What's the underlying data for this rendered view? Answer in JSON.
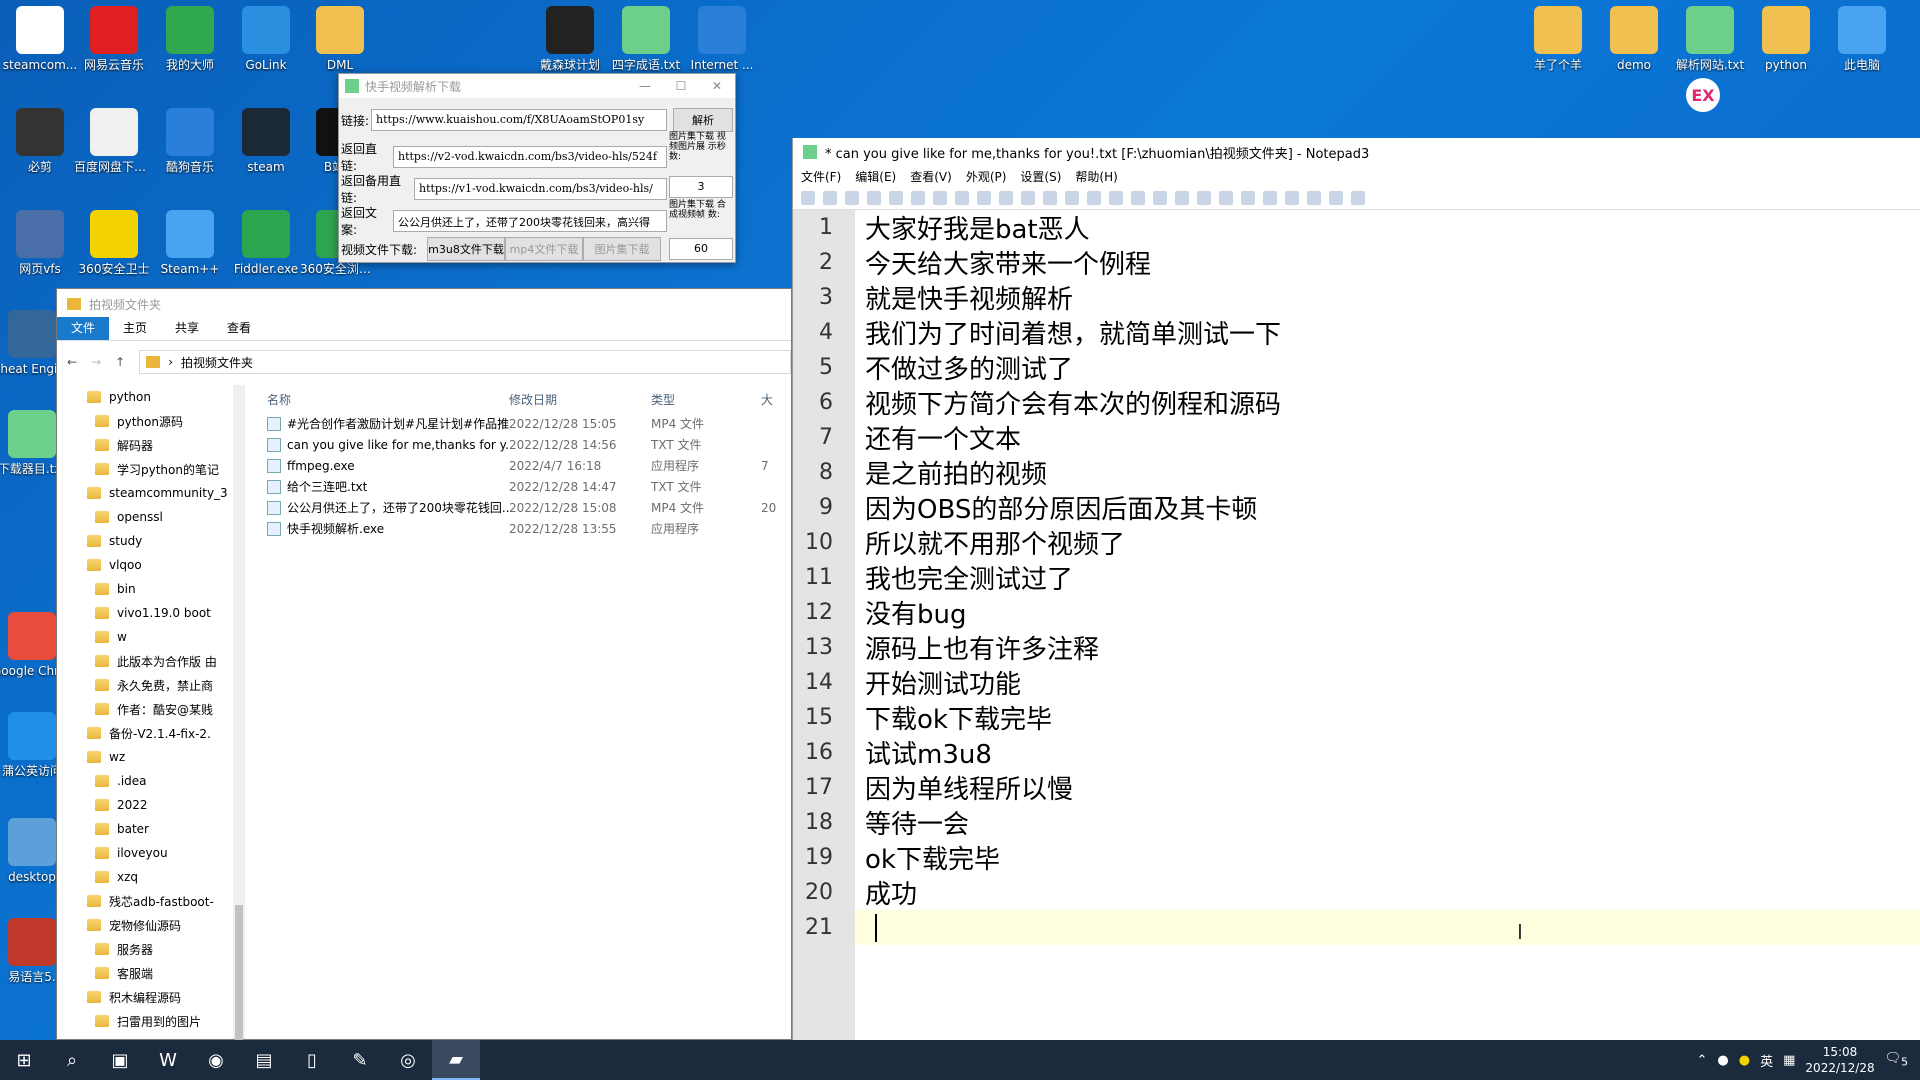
{
  "desktop": {
    "icons_left": [
      {
        "label": "steamcom...",
        "color": "#ffffff"
      },
      {
        "label": "网易云音乐",
        "color": "#e02020"
      },
      {
        "label": "我的大师",
        "color": "#2fa84f"
      },
      {
        "label": "GoLink",
        "color": "#2b8fe0"
      },
      {
        "label": "DML",
        "color": "#f0c050"
      },
      {
        "label": "戴森球计划",
        "color": "#222222"
      },
      {
        "label": "四字成语.txt",
        "color": "#6ccf8a"
      },
      {
        "label": "Internet ...",
        "color": "#2a7fd8"
      }
    ],
    "icons_row2": [
      {
        "label": "必剪",
        "color": "#333333"
      },
      {
        "label": "百度网盘下载 完毕提示音...",
        "color": "#f0f0f0"
      },
      {
        "label": "酷狗音乐",
        "color": "#2a7fd8"
      },
      {
        "label": "steam",
        "color": "#1b2838"
      },
      {
        "label": "B站弹",
        "color": "#111111"
      }
    ],
    "icons_row3": [
      {
        "label": "网页vfs",
        "color": "#4a6fa8"
      },
      {
        "label": "360安全卫士",
        "color": "#f2d200"
      },
      {
        "label": "Steam++",
        "color": "#4aa3f0"
      },
      {
        "label": "Fiddler.exe",
        "color": "#2da44e"
      },
      {
        "label": "360安全浏览器",
        "color": "#2da44e"
      }
    ],
    "icons_col": [
      {
        "label": "Cheat Engine",
        "color": "#336699"
      },
      {
        "label": "下载器目.txt",
        "color": "#6ccf8a"
      },
      {
        "label": "Google Chrome",
        "color": "#e84c3d"
      },
      {
        "label": "蒲公英访问",
        "color": "#1f8fe8"
      },
      {
        "label": "desktop",
        "color": "#5ba0d8"
      },
      {
        "label": "易语言5.",
        "color": "#c0392b"
      }
    ],
    "icons_right": [
      {
        "label": "羊了个羊",
        "color": "#f0c050"
      },
      {
        "label": "demo",
        "color": "#f0c050"
      },
      {
        "label": "解析网站.txt",
        "color": "#6ccf8a"
      },
      {
        "label": "python",
        "color": "#f0c050"
      },
      {
        "label": "此电脑",
        "color": "#4aa3f0"
      }
    ],
    "ex_badge": "EX"
  },
  "tool": {
    "title": "快手视频解析下载",
    "link_label": "链接:",
    "link_value": "https://www.kuaishou.com/f/X8UAoamStOP01sy",
    "parse_button": "解析",
    "direct_label": "返回直链:",
    "direct_value": "https://v2-vod.kwaicdn.com/bs3/video-hls/524f",
    "backup_label": "返回备用直链:",
    "backup_value": "https://v1-vod.kwaicdn.com/bs3/video-hls/",
    "caption_label": "返回文案:",
    "caption_value": "公公月供还上了，还带了200块零花钱回来，高兴得",
    "download_label": "视频文件下载:",
    "m3u8_button": "m3u8文件下载",
    "mp4_button": "mp4文件下载",
    "imgset_button": "图片集下载",
    "side_label1": "图片集下载 视频图片展 示秒数:",
    "side_value1": "3",
    "side_label2": "图片集下载 合成视频帧 数:",
    "side_value2": "60"
  },
  "explorer": {
    "title": "拍视频文件夹",
    "tabs": [
      "文件",
      "主页",
      "共享",
      "查看"
    ],
    "path": "拍视频文件夹",
    "nav": [
      {
        "label": "python",
        "indent": 0
      },
      {
        "label": "python源码",
        "indent": 1
      },
      {
        "label": "解码器",
        "indent": 1
      },
      {
        "label": "学习python的笔记",
        "indent": 1
      },
      {
        "label": "steamcommunity_3",
        "indent": 0
      },
      {
        "label": "openssl",
        "indent": 1
      },
      {
        "label": "study",
        "indent": 0
      },
      {
        "label": "vlqoo",
        "indent": 0
      },
      {
        "label": "bin",
        "indent": 1
      },
      {
        "label": "vivo1.19.0 boot",
        "indent": 1
      },
      {
        "label": "w",
        "indent": 1
      },
      {
        "label": "此版本为合作版 由",
        "indent": 1
      },
      {
        "label": "永久免费，禁止商",
        "indent": 1
      },
      {
        "label": "作者：酷安@某贱",
        "indent": 1
      },
      {
        "label": "备份-V2.1.4-fix-2.",
        "indent": 0
      },
      {
        "label": "wz",
        "indent": 0
      },
      {
        "label": ".idea",
        "indent": 1
      },
      {
        "label": "2022",
        "indent": 1
      },
      {
        "label": "bater",
        "indent": 1
      },
      {
        "label": "iloveyou",
        "indent": 1
      },
      {
        "label": "xzq",
        "indent": 1
      },
      {
        "label": "残芯adb-fastboot-",
        "indent": 0
      },
      {
        "label": "宠物修仙源码",
        "indent": 0
      },
      {
        "label": "服务器",
        "indent": 1
      },
      {
        "label": "客服端",
        "indent": 1
      },
      {
        "label": "积木编程源码",
        "indent": 0
      },
      {
        "label": "扫雷用到的图片",
        "indent": 1
      }
    ],
    "columns": [
      "名称",
      "修改日期",
      "类型",
      "大"
    ],
    "files": [
      {
        "name": "#光合创作者激励计划#凡星计划#作品推...",
        "date": "2022/12/28 15:05",
        "type": "MP4 文件",
        "size": ""
      },
      {
        "name": "can you give like for me,thanks for y...",
        "date": "2022/12/28 14:56",
        "type": "TXT 文件",
        "size": ""
      },
      {
        "name": "ffmpeg.exe",
        "date": "2022/4/7 16:18",
        "type": "应用程序",
        "size": "7"
      },
      {
        "name": "给个三连吧.txt",
        "date": "2022/12/28 14:47",
        "type": "TXT 文件",
        "size": ""
      },
      {
        "name": "公公月供还上了，还带了200块零花钱回...",
        "date": "2022/12/28 15:08",
        "type": "MP4 文件",
        "size": "20"
      },
      {
        "name": "快手视频解析.exe",
        "date": "2022/12/28 13:55",
        "type": "应用程序",
        "size": ""
      }
    ]
  },
  "notepad": {
    "title": "* can you give like for me,thanks for you!.txt [F:\\zhuomian\\拍视频文件夹] - Notepad3",
    "menu": [
      "文件(F)",
      "编辑(E)",
      "查看(V)",
      "外观(P)",
      "设置(S)",
      "帮助(H)"
    ],
    "lines": [
      "大家好我是bat恶人",
      "今天给大家带来一个例程",
      "就是快手视频解析",
      "我们为了时间着想，就简单测试一下",
      "不做过多的测试了",
      "视频下方简介会有本次的例程和源码",
      "还有一个文本",
      "是之前拍的视频",
      "因为OBS的部分原因后面及其卡顿",
      "所以就不用那个视频了",
      "我也完全测试过了",
      "没有bug",
      "源码上也有许多注释",
      "开始测试功能",
      "下载ok下载完毕",
      "试试m3u8",
      "因为单线程所以慢",
      "等待一会",
      "ok下载完毕",
      "成功",
      ""
    ]
  },
  "taskbar": {
    "start_icon": "windows-start-icon",
    "search_icon": "search-icon",
    "apps": [
      "terminal",
      "wps",
      "chrome",
      "file-explorer",
      "app-blue",
      "notepad-plus",
      "obs",
      "notepad3"
    ],
    "tray_lang": "英",
    "time": "15:08",
    "date": "2022/12/28",
    "notification_count": "5"
  }
}
